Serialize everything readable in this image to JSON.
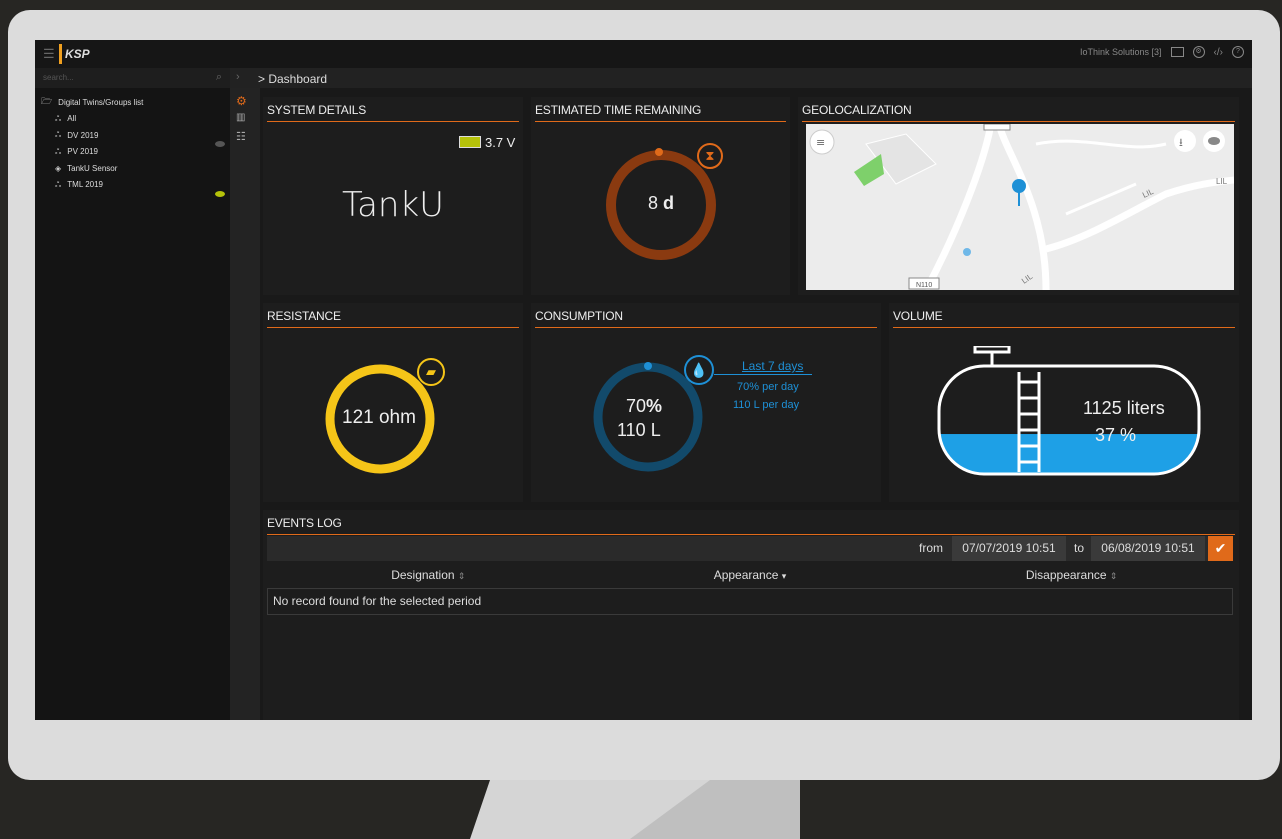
{
  "topbar": {
    "org_label": "IoThink Solutions [3]",
    "logo_text": "KSP"
  },
  "sidebar": {
    "search_placeholder": "search...",
    "tree_root": "Digital Twins/Groups list",
    "items": [
      {
        "label": "All"
      },
      {
        "label": "DV 2019"
      },
      {
        "label": "PV 2019"
      },
      {
        "label": "TankU Sensor"
      },
      {
        "label": "TML 2019"
      }
    ]
  },
  "breadcrumb": "> Dashboard",
  "panels": {
    "system": {
      "title": "SYSTEM DETAILS",
      "battery": "3.7 V",
      "name": "TankU"
    },
    "time": {
      "title": "ESTIMATED TIME REMAINING",
      "value": "8",
      "unit": "d"
    },
    "geo": {
      "title": "GEOLOCALIZATION",
      "road_label": "N110",
      "road_label2": "LIL",
      "road_label3": "LIL",
      "road_label4": "LIL"
    },
    "resistance": {
      "title": "RESISTANCE",
      "value": "121 ohm"
    },
    "consumption": {
      "title": "CONSUMPTION",
      "pct": "70",
      "liters": "110",
      "pct_sym": "%",
      "l_sym": "L",
      "period": "Last 7 days",
      "per_day_pct": "70",
      "per_day_pct_unit": "% per day",
      "per_day_l": "110",
      "per_day_l_unit": "L per day"
    },
    "volume": {
      "title": "VOLUME",
      "liters": "1125 liters",
      "pct": "37 %",
      "level": 0.37
    }
  },
  "events": {
    "title": "EVENTS LOG",
    "from_label": "from",
    "from_value": "07/07/2019 10:51",
    "to_label": "to",
    "to_value": "06/08/2019 10:51",
    "columns": [
      "Designation",
      "Appearance",
      "Disappearance"
    ],
    "empty_message": "No record found for the selected period"
  },
  "colors": {
    "accent": "#e06a1a",
    "yellow": "#f5c518",
    "blue": "#1e90d6",
    "dark_orange": "#8a3a10"
  }
}
